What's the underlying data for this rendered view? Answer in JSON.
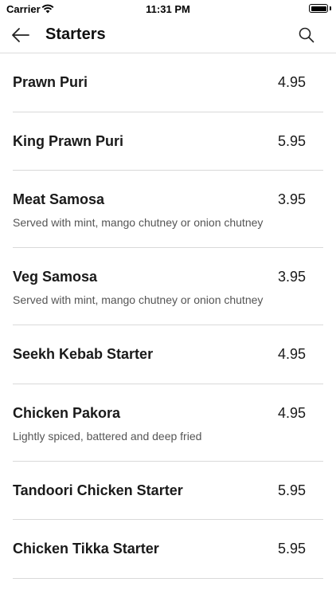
{
  "status_bar": {
    "carrier": "Carrier",
    "time": "11:31 PM"
  },
  "nav": {
    "title": "Starters",
    "back_icon": "arrow-left-icon",
    "search_icon": "search-icon"
  },
  "items": [
    {
      "name": "Prawn Puri",
      "price": "4.95",
      "description": ""
    },
    {
      "name": "King Prawn Puri",
      "price": "5.95",
      "description": ""
    },
    {
      "name": "Meat Samosa",
      "price": "3.95",
      "description": "Served with mint, mango chutney or onion chutney"
    },
    {
      "name": "Veg Samosa",
      "price": "3.95",
      "description": "Served with mint, mango chutney or onion chutney"
    },
    {
      "name": "Seekh Kebab Starter",
      "price": "4.95",
      "description": ""
    },
    {
      "name": "Chicken Pakora",
      "price": "4.95",
      "description": "Lightly spiced, battered and deep fried"
    },
    {
      "name": "Tandoori Chicken Starter",
      "price": "5.95",
      "description": ""
    },
    {
      "name": "Chicken Tikka Starter",
      "price": "5.95",
      "description": ""
    }
  ]
}
